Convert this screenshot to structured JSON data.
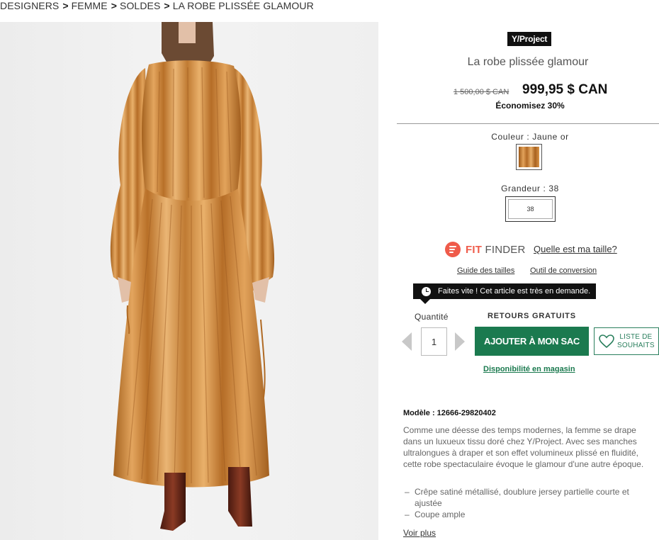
{
  "breadcrumb": [
    {
      "label": "DESIGNERS"
    },
    {
      "label": "FEMME"
    },
    {
      "label": "SOLDES"
    },
    {
      "label": "LA ROBE PLISSÉE GLAMOUR"
    }
  ],
  "breadcrumb_separator": ">",
  "product": {
    "brand": "Y/Project",
    "name": "La robe plissée glamour",
    "old_price": "1 500,00 $ CAN",
    "price": "999,95 $ CAN",
    "savings": "Économisez 30%"
  },
  "options": {
    "color_label": "Couleur : Jaune or",
    "size_label": "Grandeur : 38",
    "selected_size": "38"
  },
  "fit_finder": {
    "logo_bold": "FIT",
    "logo_rest": "FINDER",
    "link": "Quelle est ma taille?"
  },
  "links": {
    "size_guide": "Guide des tailles",
    "conversion_tool": "Outil de conversion"
  },
  "urgency_message": "Faites vite ! Cet article est très en demande.",
  "purchase": {
    "quantity_label": "Quantité",
    "quantity_value": "1",
    "free_returns": "RETOURS GRATUITS",
    "add_to_bag": "AJOUTER À MON SAC",
    "wishlist_line1": "LISTE DE",
    "wishlist_line2": "SOUHAITS",
    "store_availability": "Disponibilité en magasin"
  },
  "details": {
    "model": "Modèle : 12666-29820402",
    "description": "Comme une déesse des temps modernes, la femme se drape dans un luxueux tissu doré chez Y/Project. Avec ses manches ultralongues à draper et son effet volumineux plissé en fluidité, cette robe spectaculaire évoque le glamour d'une autre époque.",
    "features": [
      "Crêpe satiné métallisé, doublure jersey partielle courte et ajustée",
      "Coupe ample"
    ],
    "see_more": "Voir plus"
  },
  "colors": {
    "accent_green": "#1b7a4f",
    "fit_finder_red": "#ef5b4a",
    "dress_gold": "#d6964a"
  },
  "icons": {
    "clock": "clock-icon",
    "heart": "heart-icon",
    "fit_finder": "fit-finder-logo-icon"
  }
}
